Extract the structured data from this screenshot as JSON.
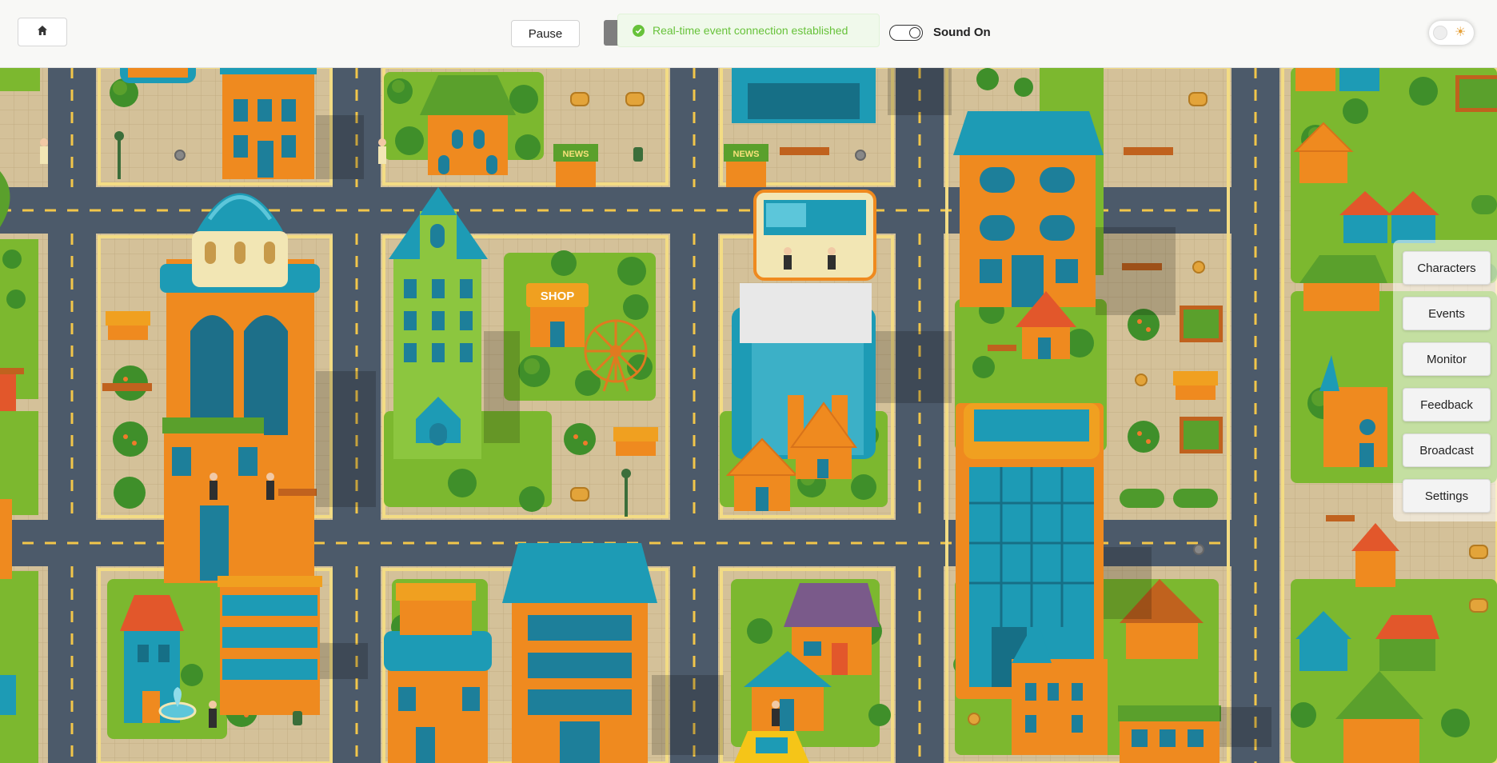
{
  "header": {
    "home_icon": "home-icon",
    "pause_label": "Pause",
    "toast_message": "Real-time event connection established",
    "toast_icon": "check-circle-icon",
    "toast_color": "#67c23a",
    "sound_label": "Sound On",
    "sound_enabled": true,
    "theme_icon": "sun-icon"
  },
  "map": {
    "signs": {
      "news": "NEWS",
      "shop": "SHOP"
    }
  },
  "side_panel": {
    "buttons": [
      "Characters",
      "Events",
      "Monitor",
      "Feedback",
      "Broadcast",
      "Settings"
    ]
  },
  "colors": {
    "road": "#4c5a6a",
    "grass": "#7cb82f",
    "plaza": "#d2bf95",
    "building_orange": "#ef8a1f",
    "building_teal": "#1d9bb5",
    "roof_green": "#5aa02c",
    "roof_red": "#e2572b"
  }
}
